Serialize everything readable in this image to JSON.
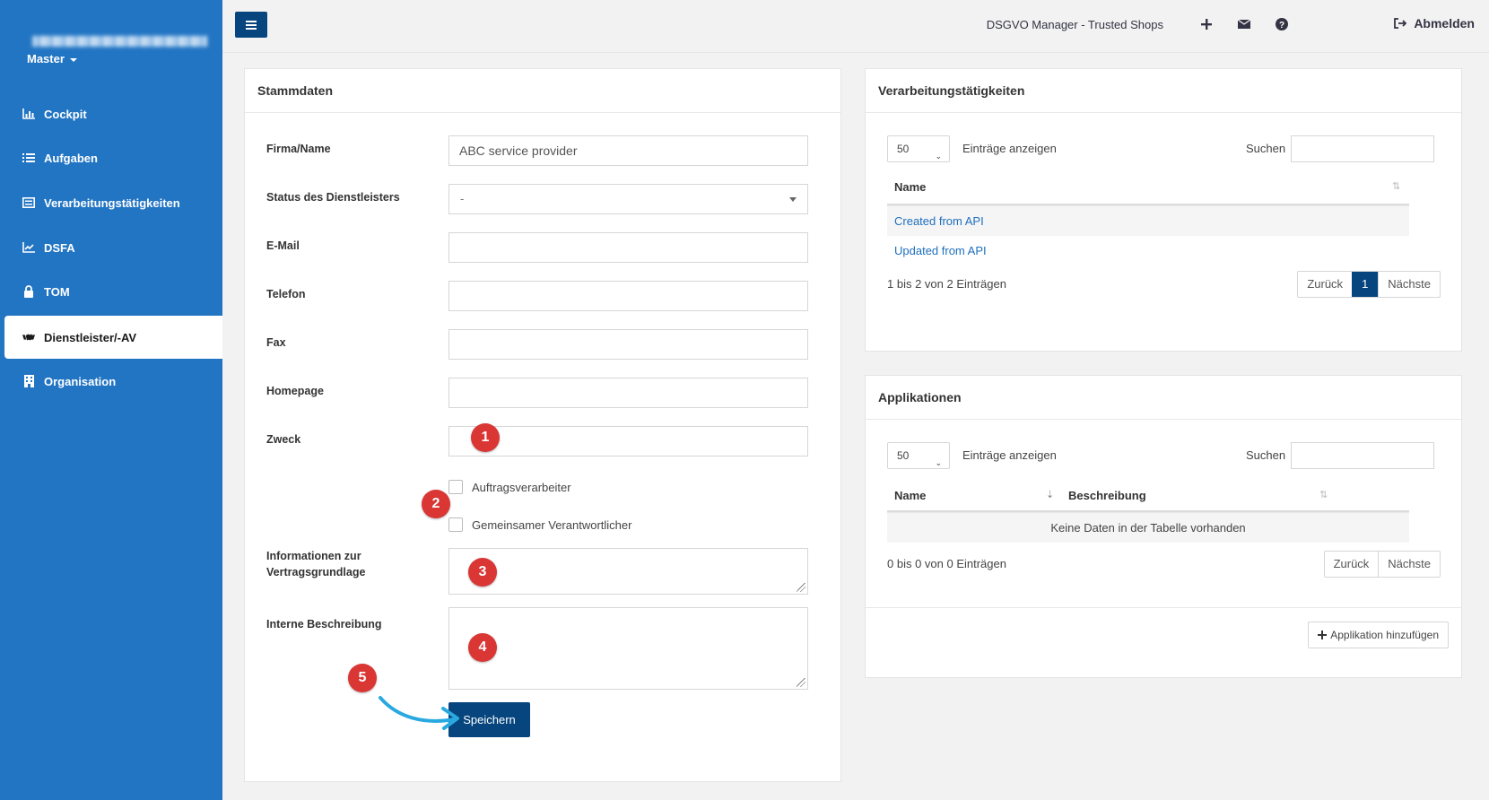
{
  "sidebar": {
    "master_label": "Master",
    "items": [
      {
        "label": "Cockpit",
        "icon": "bar-chart-icon"
      },
      {
        "label": "Aufgaben",
        "icon": "list-icon"
      },
      {
        "label": "Verarbeitungstätigkeiten",
        "icon": "table-icon"
      },
      {
        "label": "DSFA",
        "icon": "line-chart-icon"
      },
      {
        "label": "TOM",
        "icon": "lock-icon"
      },
      {
        "label": "Dienstleister/-AV",
        "icon": "handshake-icon",
        "active": true
      },
      {
        "label": "Organisation",
        "icon": "building-icon"
      }
    ]
  },
  "topbar": {
    "title": "DSGVO Manager - Trusted Shops",
    "logout_label": "Abmelden"
  },
  "stammdaten": {
    "heading": "Stammdaten",
    "firma_label": "Firma/Name",
    "firma_value": "ABC service provider",
    "status_label": "Status des Dienstleisters",
    "status_value": "-",
    "email_label": "E-Mail",
    "telefon_label": "Telefon",
    "fax_label": "Fax",
    "homepage_label": "Homepage",
    "zweck_label": "Zweck",
    "cb_auftrag": "Auftragsverarbeiter",
    "cb_gemeinsam": "Gemeinsamer Verantwortlicher",
    "info_label": "Informationen zur Vertragsgrundlage",
    "intern_label": "Interne Beschreibung",
    "save_label": "Speichern"
  },
  "badges": [
    "1",
    "2",
    "3",
    "4",
    "5"
  ],
  "verarbeitung": {
    "heading": "Verarbeitungstätigkeiten",
    "length_value": "50",
    "length_label": "Einträge anzeigen",
    "search_label": "Suchen",
    "col_name": "Name",
    "rows": [
      "Created from API",
      "Updated from API"
    ],
    "info": "1 bis 2 von 2 Einträgen",
    "prev": "Zurück",
    "page": "1",
    "next": "Nächste"
  },
  "applikationen": {
    "heading": "Applikationen",
    "length_value": "50",
    "length_label": "Einträge anzeigen",
    "search_label": "Suchen",
    "col_name": "Name",
    "col_desc": "Beschreibung",
    "empty": "Keine Daten in der Tabelle vorhanden",
    "info": "0 bis 0 von 0 Einträgen",
    "prev": "Zurück",
    "next": "Nächste",
    "add_label": "Applikation hinzufügen"
  },
  "colors": {
    "sidebar": "#2275c3",
    "primary": "#06457e",
    "badge": "#d93634",
    "arrow": "#29a9e0"
  }
}
